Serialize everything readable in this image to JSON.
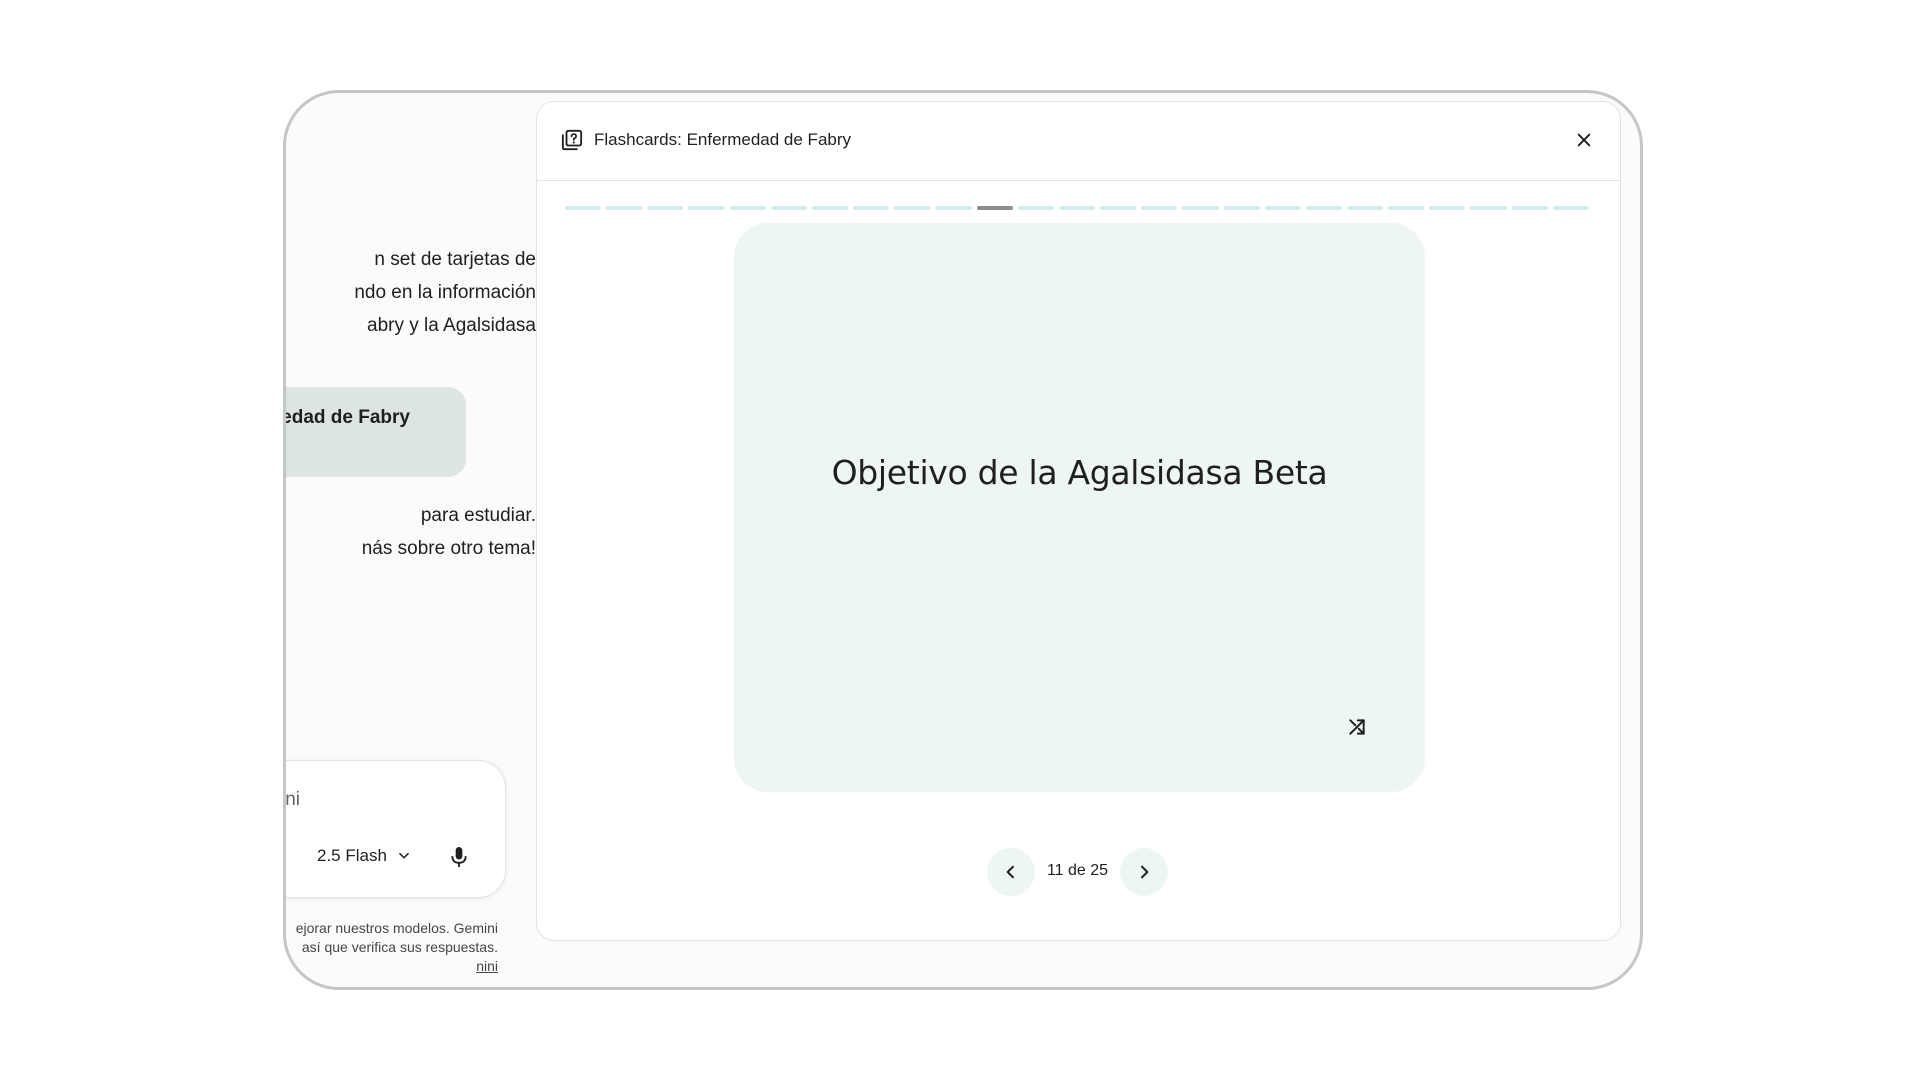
{
  "chat": {
    "message_lines": [
      "n set de tarjetas de",
      "ndo en la información",
      "abry y la Agalsidasa"
    ],
    "chip_label": "edad de Fabry",
    "followup_lines": [
      "para estudiar.",
      "nás sobre otro tema!"
    ],
    "input_placeholder": "mini",
    "model_label": "2.5 Flash",
    "disclaimer_lines": [
      "ejorar nuestros modelos. Gemini",
      "así que verifica sus respuestas.",
      "nini"
    ]
  },
  "flashcards": {
    "title": "Flashcards: Enfermedad de Fabry",
    "total": 25,
    "current": 11,
    "card_text": "Objetivo de la Agalsidasa Beta",
    "counter_label": "11 de 25"
  },
  "icons": {
    "header": "flashcards-icon",
    "close": "close-icon",
    "shuffle": "shuffle-icon",
    "prev": "chevron-left-icon",
    "next": "chevron-right-icon",
    "model_dropdown": "chevron-down-icon",
    "mic": "microphone-icon"
  },
  "colors": {
    "card_background": "#edf6f5",
    "progress_inactive": "#d4ecee",
    "progress_active": "#8e8e8e",
    "chip_background": "#dde4e4"
  }
}
